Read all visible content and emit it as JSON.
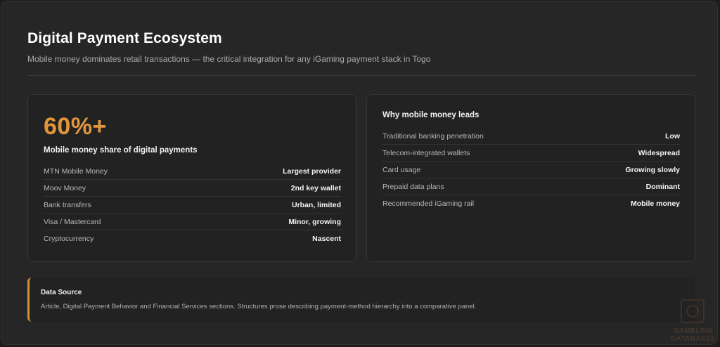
{
  "header": {
    "title": "Digital Payment Ecosystem",
    "subtitle": "Mobile money dominates retail transactions — the critical integration for any iGaming payment stack in Togo"
  },
  "left_card": {
    "stat": "60%+",
    "stat_label": "Mobile money share of digital payments",
    "rows": [
      {
        "label": "MTN Mobile Money",
        "value": "Largest provider"
      },
      {
        "label": "Moov Money",
        "value": "2nd key wallet"
      },
      {
        "label": "Bank transfers",
        "value": "Urban, limited"
      },
      {
        "label": "Visa / Mastercard",
        "value": "Minor, growing"
      },
      {
        "label": "Cryptocurrency",
        "value": "Nascent"
      }
    ]
  },
  "right_card": {
    "heading": "Why mobile money leads",
    "rows": [
      {
        "label": "Traditional banking penetration",
        "value": "Low"
      },
      {
        "label": "Telecom-integrated wallets",
        "value": "Widespread"
      },
      {
        "label": "Card usage",
        "value": "Growing slowly"
      },
      {
        "label": "Prepaid data plans",
        "value": "Dominant"
      },
      {
        "label": "Recommended iGaming rail",
        "value": "Mobile money"
      }
    ]
  },
  "source": {
    "title": "Data Source",
    "text": "Article, Digital Payment Behavior and Financial Services sections. Structures prose describing payment-method hierarchy into a comparative panel."
  },
  "watermark": {
    "line1": "GAMBLING",
    "line2": "DATABASES"
  },
  "colors": {
    "accent": "#e2963c",
    "background": "#262626",
    "card": "#222222"
  }
}
